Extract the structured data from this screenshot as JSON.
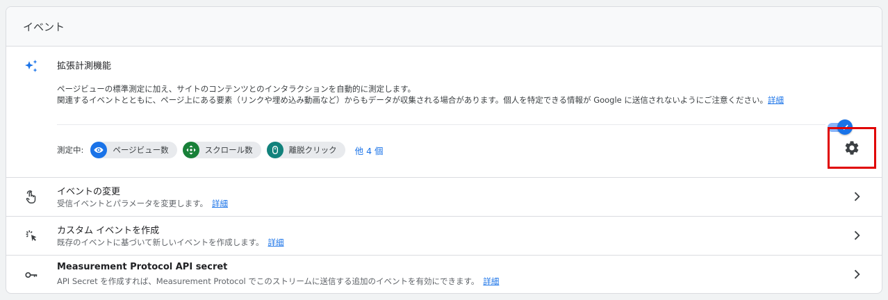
{
  "header": {
    "title": "イベント"
  },
  "enhanced": {
    "title": "拡張計測機能",
    "desc_line1": "ページビューの標準測定に加え、サイトのコンテンツとのインタラクションを自動的に測定します。",
    "desc_line2": "関連するイベントとともに、ページ上にある要素（リンクや埋め込み動画など）からもデータが収集される場合があります。個人を特定できる情報が Google に送信されないようにご注意ください。",
    "details_link": "詳細",
    "toggle_on": true,
    "measuring_label": "測定中:",
    "chips": [
      {
        "label": "ページビュー数",
        "icon": "eye-icon",
        "color": "#1a73e8"
      },
      {
        "label": "スクロール数",
        "icon": "scroll-icon",
        "color": "#188038"
      },
      {
        "label": "離脱クリック",
        "icon": "mouse-icon",
        "color": "#12827c"
      }
    ],
    "more_link": "他 4 個"
  },
  "rows": [
    {
      "title": "イベントの変更",
      "subtitle": "受信イベントとパラメータを変更します。",
      "link": "詳細",
      "icon": "touch-icon"
    },
    {
      "title": "カスタム イベントを作成",
      "subtitle": "既存のイベントに基づいて新しいイベントを作成します。",
      "link": "詳細",
      "icon": "click-icon"
    },
    {
      "title": "Measurement Protocol API secret",
      "subtitle": "API Secret を作成すれば、Measurement Protocol でこのストリームに送信する追加のイベントを有効にできます。",
      "link": "詳細",
      "icon": "key-icon"
    }
  ],
  "colors": {
    "accent": "#1a73e8",
    "highlight": "#e00000"
  }
}
